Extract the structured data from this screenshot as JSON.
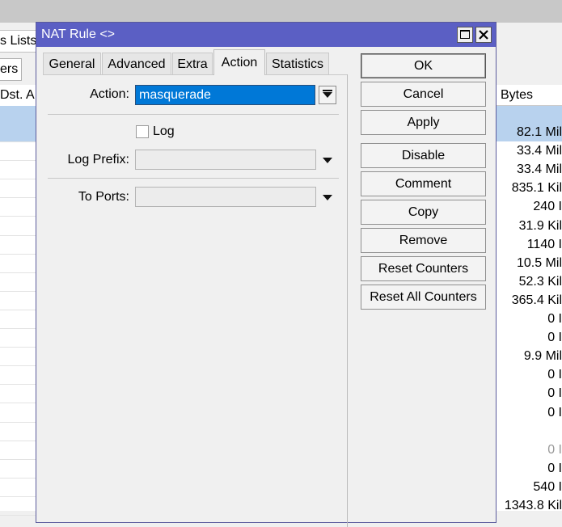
{
  "background": {
    "tab_label": "s Lists",
    "filter_label": "ers",
    "col_left_label": "Dst. A",
    "col_right_label": "Bytes",
    "bytes_rows": [
      "82.1 Mil",
      "33.4 Mil",
      "33.4 Mil",
      "835.1 Kil",
      "240 I",
      "31.9 Kil",
      "1140 I",
      "10.5 Mil",
      "52.3 Kil",
      "365.4 Kil",
      "0 I",
      "0 I",
      "9.9 Mil",
      "0 I",
      "0 I",
      "0 I",
      "",
      "0 I",
      "0 I",
      "540 I",
      "1343.8 Kil"
    ]
  },
  "dialog": {
    "title": "NAT Rule <>",
    "tabs": [
      "General",
      "Advanced",
      "Extra",
      "Action",
      "Statistics"
    ],
    "active_tab": "Action",
    "form": {
      "action_label": "Action:",
      "action_value": "masquerade",
      "log_label": "Log",
      "log_checked": false,
      "log_prefix_label": "Log Prefix:",
      "log_prefix_value": "",
      "to_ports_label": "To Ports:",
      "to_ports_value": ""
    },
    "buttons": {
      "ok": "OK",
      "cancel": "Cancel",
      "apply": "Apply",
      "disable": "Disable",
      "comment": "Comment",
      "copy": "Copy",
      "remove": "Remove",
      "reset_counters": "Reset Counters",
      "reset_all_counters": "Reset All Counters"
    }
  },
  "colors": {
    "titlebar": "#5b5fc4",
    "selection": "#0078d7",
    "row_highlight": "#b8d2ee"
  }
}
